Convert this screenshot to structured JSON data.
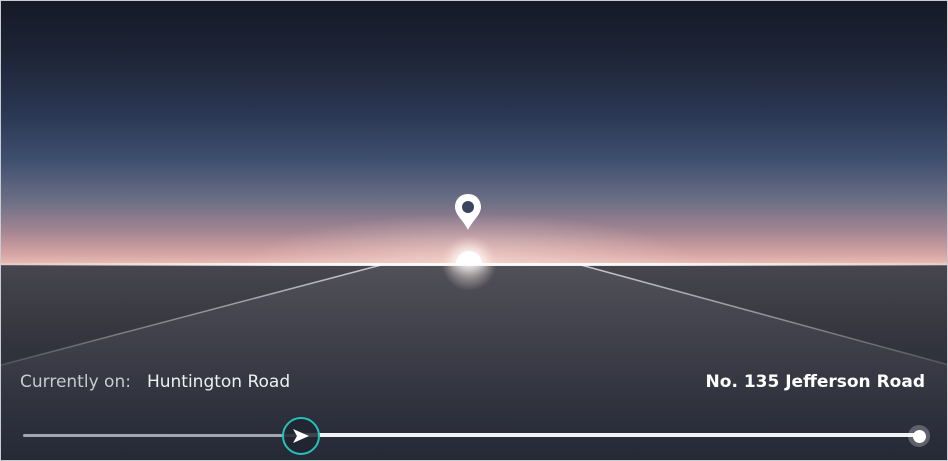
{
  "route": {
    "current_label": "Currently on:",
    "current_road": "Huntington Road",
    "destination": "No. 135 Jefferson Road",
    "progress": 0.31
  },
  "icons": {
    "location_pin": "location-pin-icon",
    "navigation_arrow": "navigation-arrow-icon",
    "destination_dot": "destination-dot-icon"
  },
  "colors": {
    "accent": "#25c2b9",
    "text_primary": "#ffffff",
    "text_secondary": "#c8cad2"
  }
}
